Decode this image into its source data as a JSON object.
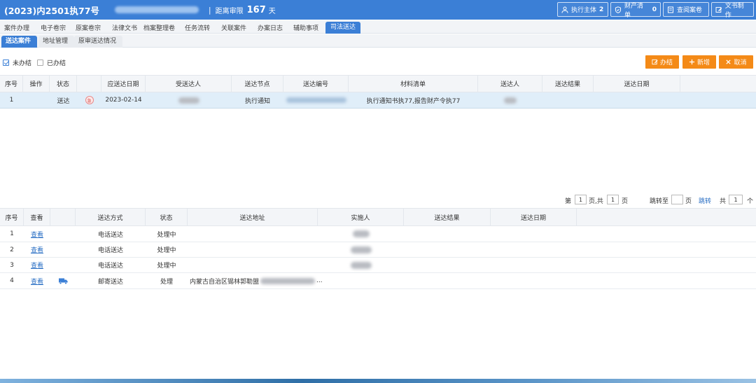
{
  "header": {
    "case_no": "(2023)内2501执77号",
    "separator": "|",
    "deadline_label": "距离审限",
    "deadline_days": "167",
    "deadline_unit": "天",
    "buttons": [
      {
        "label": "执行主体",
        "count": "2",
        "icon": "person-icon"
      },
      {
        "label": "财产清单",
        "count": "0",
        "icon": "shield-icon"
      },
      {
        "label": "查阅案卷",
        "icon": "book-icon"
      },
      {
        "label": "文书制作",
        "icon": "edit-icon"
      }
    ]
  },
  "main_tabs": [
    "案件办理",
    "电子卷宗",
    "原案卷宗",
    "法律文书",
    "档案整理卷",
    "任务流转",
    "关联案件",
    "办案日志",
    "辅助事项",
    "司法送达"
  ],
  "active_main_tab": "司法送达",
  "sub_tabs": [
    "送达案件",
    "地址管理",
    "原审送达情况"
  ],
  "active_sub_tab": "送达案件",
  "filters": [
    {
      "label": "未办结",
      "checked": true
    },
    {
      "label": "已办结",
      "checked": false
    }
  ],
  "actions": [
    {
      "label": "办结",
      "icon": "edit-icon"
    },
    {
      "label": "新增",
      "icon": "plus-icon"
    },
    {
      "label": "取消",
      "icon": "close-icon"
    }
  ],
  "table1": {
    "headers": [
      "序号",
      "操作",
      "状态",
      "",
      "应送达日期",
      "受送达人",
      "送达节点",
      "送达编号",
      "材料清单",
      "送达人",
      "送达结果",
      "送达日期"
    ],
    "rows": [
      {
        "no": "1",
        "op": "",
        "status": "送达",
        "badge": "急",
        "due_date": "2023-02-14",
        "node": "执行通知",
        "materials": "执行通知书执77,报告财产令执77"
      }
    ]
  },
  "pager": {
    "page_prefix": "第",
    "page": "1",
    "page_suffix": "页,共",
    "total_pages": "1",
    "total_suffix": "页",
    "jump_label": "跳转至",
    "jump_suffix": "页",
    "jump_button": "跳转",
    "count_prefix": "共",
    "count": "1",
    "count_suffix": "个"
  },
  "table2": {
    "headers": [
      "序号",
      "查看",
      "",
      "送达方式",
      "状态",
      "送达地址",
      "实施人",
      "送达结果",
      "送达日期"
    ],
    "rows": [
      {
        "no": "1",
        "view": "查看",
        "method": "电话送达",
        "status": "处理中",
        "address": "",
        "truck": false
      },
      {
        "no": "2",
        "view": "查看",
        "method": "电话送达",
        "status": "处理中",
        "address": "",
        "truck": false
      },
      {
        "no": "3",
        "view": "查看",
        "method": "电话送达",
        "status": "处理中",
        "address": "",
        "truck": false
      },
      {
        "no": "4",
        "view": "查看",
        "method": "邮寄送达",
        "status": "处理",
        "address": "内蒙古自治区锡林郭勒盟",
        "address_tail": "...",
        "truck": true
      }
    ]
  },
  "colors": {
    "primary": "#3b7fd6",
    "accent": "#f48a17",
    "selected_row": "#e0eef9",
    "link": "#2a6fc4"
  }
}
